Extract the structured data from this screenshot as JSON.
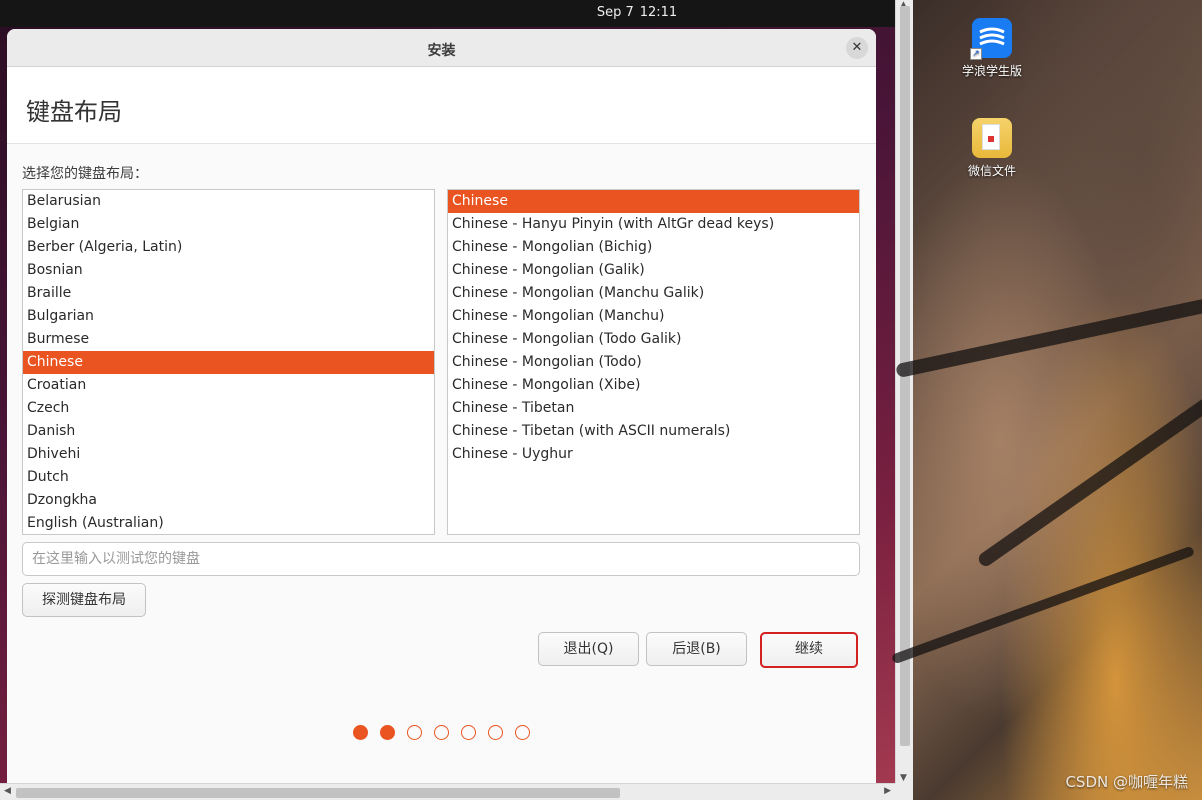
{
  "system": {
    "date": "Sep 7",
    "time": "12:11"
  },
  "window": {
    "title": "安装",
    "close_icon": "close-icon"
  },
  "page": {
    "heading": "键盘布局",
    "prompt": "选择您的键盘布局："
  },
  "layouts": {
    "items": [
      "Belarusian",
      "Belgian",
      "Berber (Algeria, Latin)",
      "Bosnian",
      "Braille",
      "Bulgarian",
      "Burmese",
      "Chinese",
      "Croatian",
      "Czech",
      "Danish",
      "Dhivehi",
      "Dutch",
      "Dzongkha",
      "English (Australian)"
    ],
    "selected": "Chinese"
  },
  "variants": {
    "items": [
      "Chinese",
      "Chinese - Hanyu Pinyin (with AltGr dead keys)",
      "Chinese - Mongolian (Bichig)",
      "Chinese - Mongolian (Galik)",
      "Chinese - Mongolian (Manchu Galik)",
      "Chinese - Mongolian (Manchu)",
      "Chinese - Mongolian (Todo Galik)",
      "Chinese - Mongolian (Todo)",
      "Chinese - Mongolian (Xibe)",
      "Chinese - Tibetan",
      "Chinese - Tibetan (with ASCII numerals)",
      "Chinese - Uyghur"
    ],
    "selected": "Chinese"
  },
  "test_input": {
    "placeholder": "在这里输入以测试您的键盘",
    "value": ""
  },
  "buttons": {
    "detect": "探测键盘布局",
    "quit": "退出(Q)",
    "back": "后退(B)",
    "continue": "继续"
  },
  "progress": {
    "total_steps": 7,
    "completed_steps": 2
  },
  "desktop": {
    "icons": [
      {
        "label": "学浪学生版",
        "icon": "xuelang-app-icon"
      },
      {
        "label": "微信文件",
        "icon": "folder-icon"
      }
    ],
    "watermark": "CSDN @咖喱年糕"
  },
  "colors": {
    "accent": "#e95420",
    "highlight_border": "#d32020"
  }
}
